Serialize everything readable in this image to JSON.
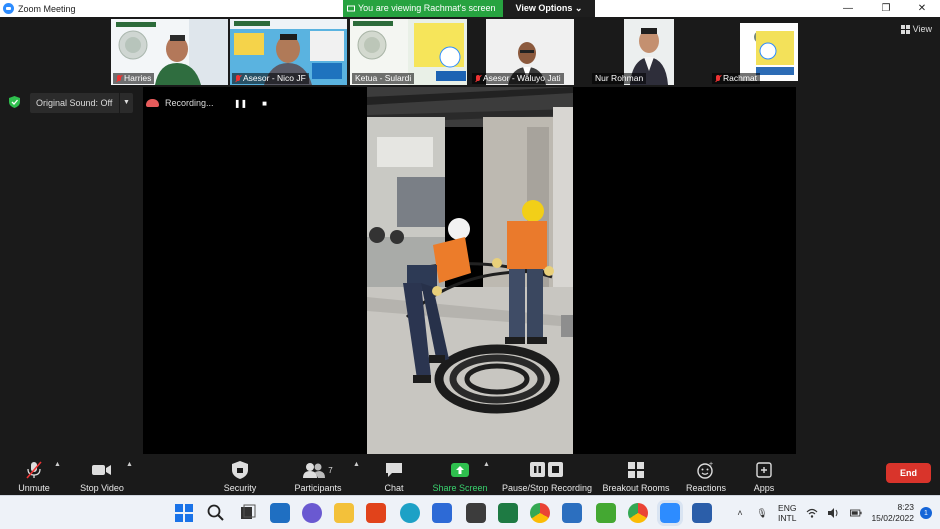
{
  "window": {
    "title": "Zoom Meeting",
    "viewing_banner": "You are viewing Rachmat's screen",
    "view_options": "View Options",
    "view_button": "View"
  },
  "participants": [
    {
      "name": "Harries",
      "muted": true
    },
    {
      "name": "Asesor - Nico JF",
      "muted": true
    },
    {
      "name": "Ketua - Sulardi",
      "muted": false
    },
    {
      "name": "Asesor - Waluyo Jati",
      "muted": true
    },
    {
      "name": "Nur Rohman",
      "muted": false
    },
    {
      "name": "Rachmat",
      "muted": true
    }
  ],
  "audio": {
    "original_sound": "Original Sound: Off"
  },
  "recording": {
    "status": "Recording..."
  },
  "toolbar": {
    "unmute": "Unmute",
    "stop_video": "Stop Video",
    "security": "Security",
    "participants": "Participants",
    "participants_count": "7",
    "chat": "Chat",
    "share_screen": "Share Screen",
    "pause_stop_recording": "Pause/Stop Recording",
    "breakout_rooms": "Breakout Rooms",
    "reactions": "Reactions",
    "apps": "Apps",
    "end": "End"
  },
  "taskbar": {
    "lang_top": "ENG",
    "lang_bottom": "INTL",
    "time": "8:23",
    "date": "15/02/2022",
    "notifications": "1"
  },
  "colors": {
    "accent_green": "#27a340",
    "end_red": "#d9342b",
    "zoom_blue": "#2d8cff"
  }
}
